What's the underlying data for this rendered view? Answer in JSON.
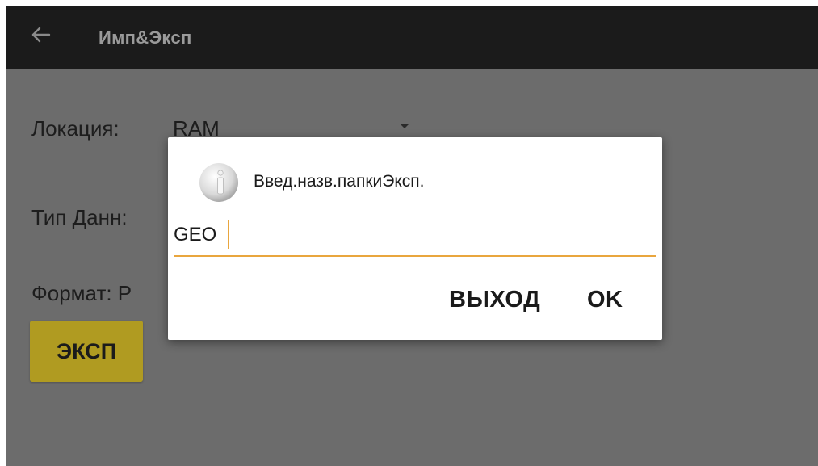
{
  "app_bar": {
    "back_icon": "arrow-left-icon",
    "title": "Имп&Эксп"
  },
  "form": {
    "location_label": "Локация:",
    "location_value": "RAM",
    "data_type_label": "Тип Данн:",
    "format_label": "Формат: Р",
    "export_button": "ЭКСП"
  },
  "dialog": {
    "icon": "info-icon",
    "title": "Введ.назв.папкиЭксп.",
    "input_value": "GEO",
    "input_accent_color": "#e9a63e",
    "exit_button": "ВЫХОД",
    "ok_button": "OK"
  },
  "colors": {
    "app_bar": "#1b1b1b",
    "dimmed_background": "#6c6c6c",
    "export_button": "#b09b21"
  }
}
